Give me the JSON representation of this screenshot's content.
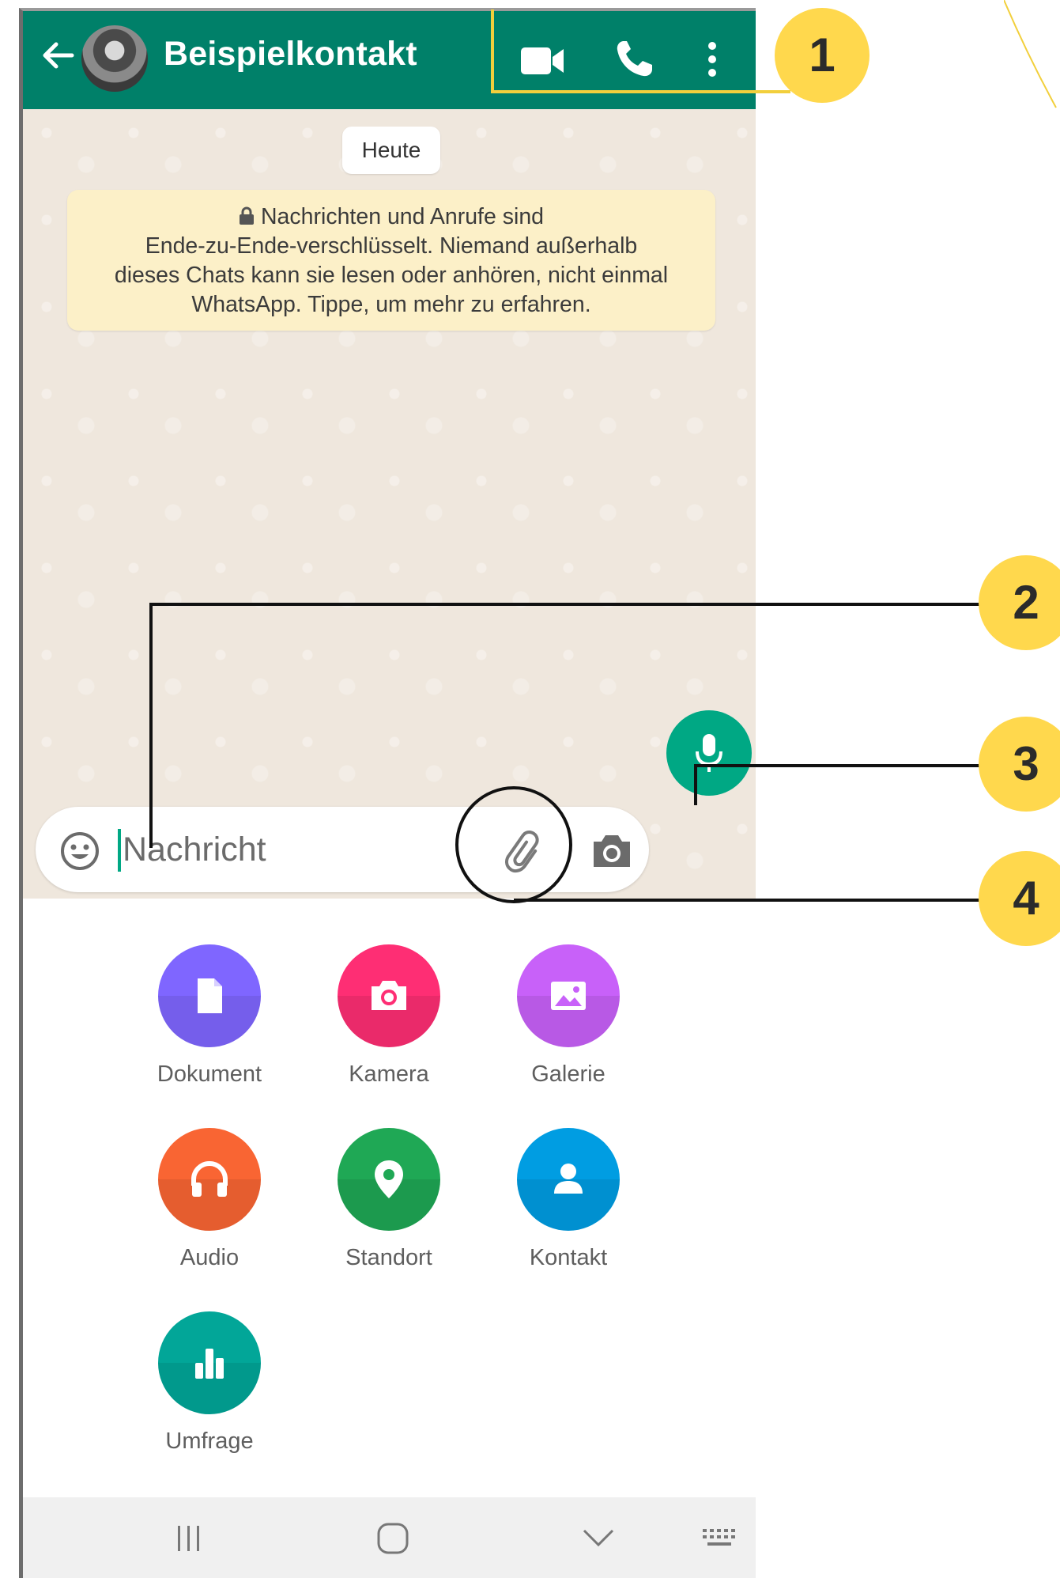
{
  "header": {
    "contact_name": "Beispielkontakt",
    "background_color": "#008069",
    "icons": [
      "back-arrow-icon",
      "avatar",
      "video-camera-icon",
      "phone-icon",
      "more-vert-icon"
    ]
  },
  "chat": {
    "date_chip": "Heute",
    "encryption_notice": {
      "lines": [
        "Nachrichten und Anrufe sind",
        "Ende-zu-Ende-verschlüsselt. Niemand außerhalb",
        "dieses Chats kann sie lesen oder anhören, nicht einmal",
        "WhatsApp. Tippe, um mehr zu erfahren."
      ],
      "background_color": "#fcf0c8"
    }
  },
  "composer": {
    "placeholder": "Nachricht",
    "icons": [
      "emoji-icon",
      "paperclip-icon",
      "camera-icon",
      "microphone-icon"
    ],
    "accent_color": "#00a884"
  },
  "attachments": [
    {
      "label": "Dokument",
      "color": "#7f66ff",
      "icon": "document-icon"
    },
    {
      "label": "Kamera",
      "color": "#fe2e74",
      "icon": "camera-icon"
    },
    {
      "label": "Galerie",
      "color": "#c861f9",
      "icon": "gallery-icon"
    },
    {
      "label": "Audio",
      "color": "#f96533",
      "icon": "headphones-icon"
    },
    {
      "label": "Standort",
      "color": "#1fa855",
      "icon": "location-pin-icon"
    },
    {
      "label": "Kontakt",
      "color": "#009de2",
      "icon": "person-icon"
    },
    {
      "label": "Umfrage",
      "color": "#02a698",
      "icon": "poll-icon"
    }
  ],
  "navigation_bar": {
    "icons": [
      "recents-icon",
      "home-icon",
      "back-chevron-icon",
      "keyboard-icon"
    ]
  },
  "annotations": {
    "badges": [
      "1",
      "2",
      "3",
      "4"
    ],
    "badge_color": "#ffd84d"
  }
}
